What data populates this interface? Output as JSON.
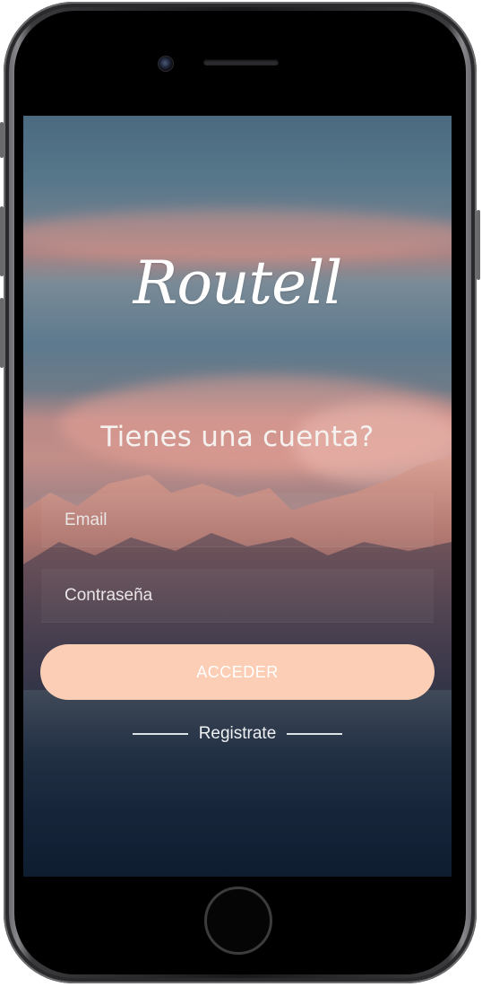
{
  "app": {
    "logo_text": "Routell"
  },
  "login": {
    "headline": "Tienes una cuenta?",
    "email_placeholder": "Email",
    "password_placeholder": "Contraseña",
    "submit_label": "ACCEDER",
    "register_label": "Registrate"
  },
  "colors": {
    "button_bg": "#fbceb5",
    "button_text": "#ffffff",
    "text": "#ffffff"
  },
  "device": {
    "camera_icon": "front-camera-icon",
    "speaker_icon": "earpiece-speaker-icon",
    "home_icon": "home-button-icon"
  }
}
